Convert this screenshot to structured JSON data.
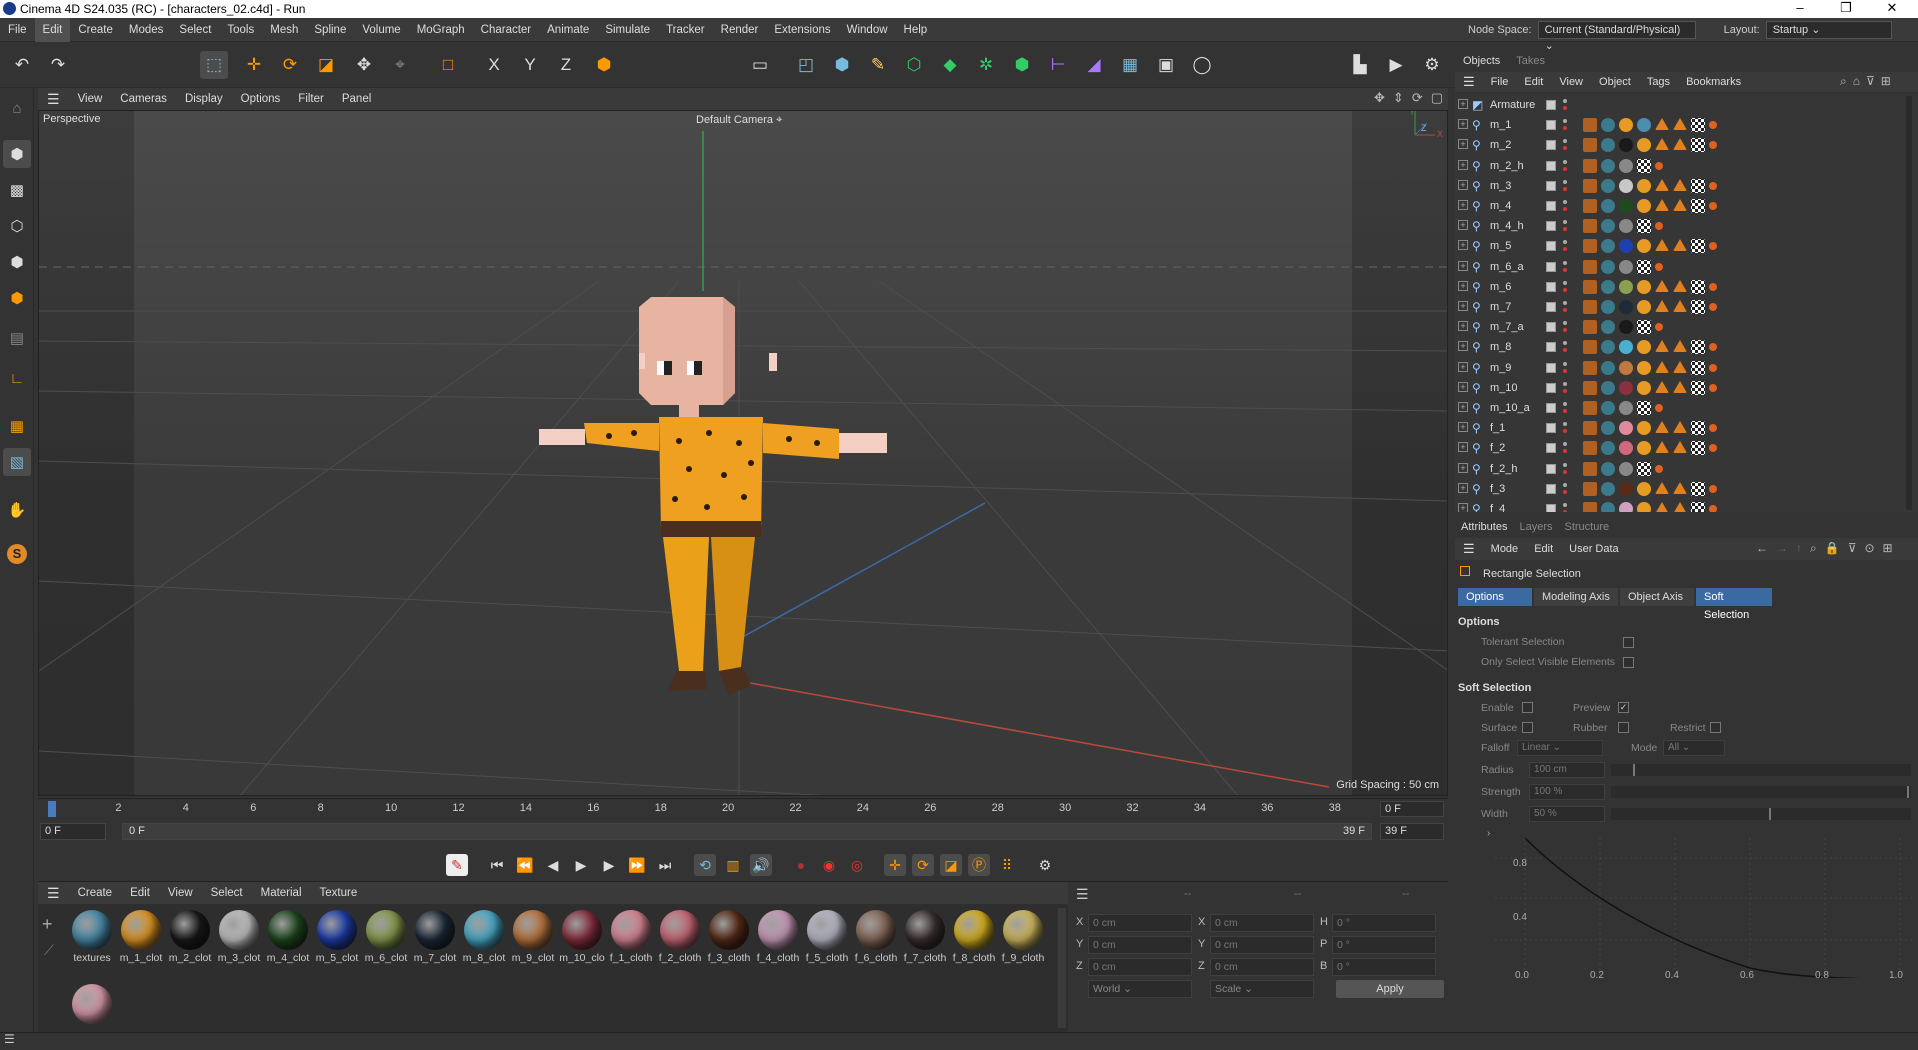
{
  "window": {
    "title": "Cinema 4D S24.035 (RC) - [characters_02.c4d] - Run",
    "controls": {
      "minimize": "–",
      "maximize": "❐",
      "close": "✕"
    }
  },
  "menubar": {
    "items": [
      "File",
      "Edit",
      "Create",
      "Modes",
      "Select",
      "Tools",
      "Mesh",
      "Spline",
      "Volume",
      "MoGraph",
      "Character",
      "Animate",
      "Simulate",
      "Tracker",
      "Render",
      "Extensions",
      "Window",
      "Help"
    ],
    "node_space_label": "Node Space:",
    "node_space_value": "Current (Standard/Physical)",
    "layout_label": "Layout:",
    "layout_value": "Startup"
  },
  "viewport": {
    "menu": [
      "View",
      "Cameras",
      "Display",
      "Options",
      "Filter",
      "Panel"
    ],
    "name": "Perspective",
    "camera": "Default Camera",
    "grid_spacing": "Grid Spacing : 50 cm",
    "axis_y": "Y",
    "axis_z": "Z",
    "axis_x": "X"
  },
  "timeline": {
    "ticks": [
      "0",
      "2",
      "4",
      "6",
      "8",
      "10",
      "12",
      "14",
      "16",
      "18",
      "20",
      "22",
      "24",
      "26",
      "28",
      "30",
      "32",
      "34",
      "36",
      "38"
    ],
    "current_frame": "0 F",
    "start_frame": "0 F",
    "range_start": "0 F",
    "range_end": "39 F",
    "end_frame": "39 F",
    "end_frame_field": "39 F"
  },
  "material_manager": {
    "menu": [
      "Create",
      "Edit",
      "View",
      "Select",
      "Material",
      "Texture"
    ],
    "materials": [
      {
        "label": "textures",
        "color": "#4a8fb0"
      },
      {
        "label": "m_1_clot",
        "color": "#e79b24"
      },
      {
        "label": "m_2_clot",
        "color": "#1a1a1a"
      },
      {
        "label": "m_3_clot",
        "color": "#c8c8c8"
      },
      {
        "label": "m_4_clot",
        "color": "#1e4a1e"
      },
      {
        "label": "m_5_clot",
        "color": "#1d3fb0"
      },
      {
        "label": "m_6_clot",
        "color": "#8aa050"
      },
      {
        "label": "m_7_clot",
        "color": "#1c2a3a"
      },
      {
        "label": "m_8_clot",
        "color": "#4ab0d0"
      },
      {
        "label": "m_9_clot",
        "color": "#c07840"
      },
      {
        "label": "m_10_clo",
        "color": "#8a3040"
      },
      {
        "label": "f_1_cloth",
        "color": "#e08a9a"
      },
      {
        "label": "f_2_cloth",
        "color": "#d06a7a"
      },
      {
        "label": "f_3_cloth",
        "color": "#5a2a18"
      },
      {
        "label": "f_4_cloth",
        "color": "#d0a0c0"
      },
      {
        "label": "f_5_cloth",
        "color": "#c0c0d0"
      },
      {
        "label": "f_6_cloth",
        "color": "#8a6a5a"
      },
      {
        "label": "f_7_cloth",
        "color": "#3a3030"
      },
      {
        "label": "f_8_cloth",
        "color": "#e0b820"
      },
      {
        "label": "f_9_cloth",
        "color": "#d8c060"
      },
      {
        "label": "",
        "color": "#e0a0b0"
      }
    ]
  },
  "coordinates": {
    "col_headers": [
      "--",
      "--",
      "--"
    ],
    "pos": {
      "x": "0 cm",
      "y": "0 cm",
      "z": "0 cm"
    },
    "size": {
      "x": "0 cm",
      "y": "0 cm",
      "z": "0 cm"
    },
    "rot": {
      "h": "0 °",
      "p": "0 °",
      "b": "0 °"
    },
    "labels": {
      "x": "X",
      "y": "Y",
      "z": "Z",
      "h": "H",
      "p": "P",
      "b": "B"
    },
    "space": "World",
    "mode": "Scale",
    "apply": "Apply"
  },
  "objects_panel": {
    "tabs": [
      "Objects",
      "Takes"
    ],
    "menu": [
      "File",
      "Edit",
      "View",
      "Object",
      "Tags",
      "Bookmarks"
    ],
    "rows": [
      "Armature",
      "m_1",
      "m_2",
      "m_2_h",
      "m_3",
      "m_4",
      "m_4_h",
      "m_5",
      "m_6_a",
      "m_6",
      "m_7",
      "m_7_a",
      "m_8",
      "m_9",
      "m_10",
      "m_10_a",
      "f_1",
      "f_2",
      "f_2_h",
      "f_3",
      "f_4"
    ]
  },
  "attributes_panel": {
    "tabs": [
      "Attributes",
      "Layers",
      "Structure"
    ],
    "menu": [
      "Mode",
      "Edit",
      "User Data"
    ],
    "tool_name": "Rectangle Selection",
    "subtabs": [
      "Options",
      "Modeling Axis",
      "Object Axis",
      "Soft Selection"
    ],
    "options_header": "Options",
    "tolerant": "Tolerant Selection",
    "only_visible": "Only Select Visible Elements",
    "soft_header": "Soft Selection",
    "enable": "Enable",
    "preview": "Preview",
    "surface": "Surface",
    "rubber": "Rubber",
    "restrict": "Restrict",
    "falloff_label": "Falloff",
    "falloff_value": "Linear",
    "mode_label": "Mode",
    "mode_value": "All",
    "radius_label": "Radius",
    "radius_value": "100 cm",
    "strength_label": "Strength",
    "strength_value": "100 %",
    "width_label": "Width",
    "width_value": "50 %",
    "graph_y": [
      "0.8",
      "0.4"
    ],
    "graph_x": [
      "0.0",
      "0.2",
      "0.4",
      "0.6",
      "0.8",
      "1.0"
    ]
  }
}
